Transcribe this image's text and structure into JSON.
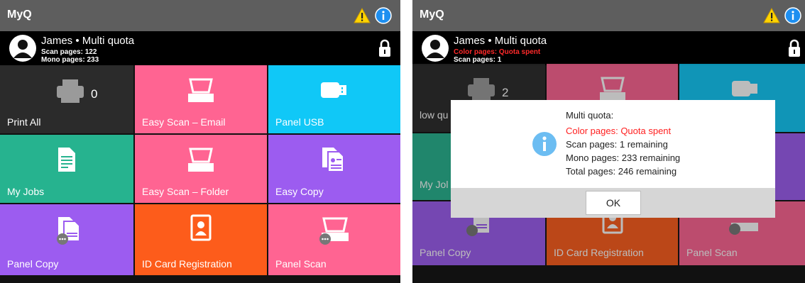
{
  "colors": {
    "topbar": "#5e5e5e",
    "dark": "#2b2b2b",
    "pink": "#ff6492",
    "cyan": "#10c8f7",
    "teal": "#26b38f",
    "purple": "#9c5cf0",
    "orange": "#fd5c1b",
    "warning": "#ffd400",
    "info": "#1e8ff0",
    "quota_red": "#ff1f1f"
  },
  "left": {
    "app_title": "MyQ",
    "user": {
      "name": "James • Multi quota",
      "lines": [
        "Scan pages: 122",
        "Mono pages: 233"
      ]
    },
    "tiles": [
      {
        "label": "Print All",
        "icon": "printer-icon",
        "count": "0"
      },
      {
        "label": "Easy Scan – Email",
        "icon": "scanner-icon"
      },
      {
        "label": "Panel USB",
        "icon": "usb-icon"
      },
      {
        "label": "My Jobs",
        "icon": "document-icon"
      },
      {
        "label": "Easy Scan – Folder",
        "icon": "scanner-icon"
      },
      {
        "label": "Easy Copy",
        "icon": "copy-icon"
      },
      {
        "label": "Panel Copy",
        "icon": "panel-copy-icon"
      },
      {
        "label": "ID Card Registration",
        "icon": "id-card-icon"
      },
      {
        "label": "Panel Scan",
        "icon": "panel-scan-icon"
      }
    ]
  },
  "right": {
    "app_title": "MyQ",
    "user": {
      "name": "James • Multi quota",
      "lines": [
        "Color pages: Quota spent",
        "Scan pages: 1"
      ]
    },
    "tiles": [
      {
        "label": "low qu",
        "icon": "printer-icon",
        "count": "2"
      },
      {
        "label": "",
        "icon": "scanner-icon"
      },
      {
        "label": "",
        "icon": "usb-icon"
      },
      {
        "label": "My Jol",
        "icon": "document-icon"
      },
      {
        "label": "",
        "icon": "scanner-icon"
      },
      {
        "label": "",
        "icon": "copy-icon"
      },
      {
        "label": "Panel Copy",
        "icon": "panel-copy-icon"
      },
      {
        "label": "ID Card Registration",
        "icon": "id-card-icon"
      },
      {
        "label": "Panel Scan",
        "icon": "panel-scan-icon"
      }
    ],
    "dialog": {
      "lines": [
        "Multi quota:",
        "Color pages: Quota spent",
        "Scan pages: 1 remaining",
        "Mono pages: 233 remaining",
        "Total pages: 246 remaining"
      ],
      "ok_label": "OK"
    }
  }
}
